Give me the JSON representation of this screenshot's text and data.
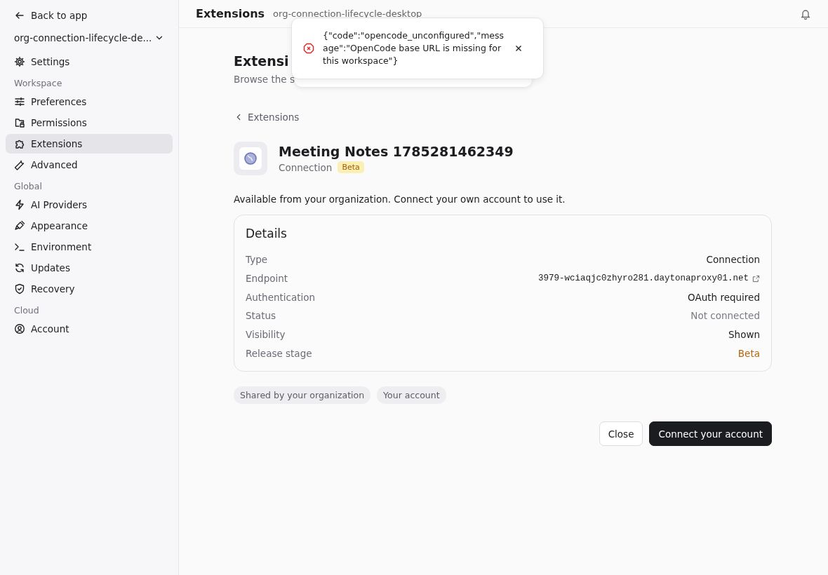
{
  "sidebar": {
    "back": "Back to app",
    "workspace": "org-connection-lifecycle-de...",
    "items": [
      {
        "kind": "item",
        "label": "Settings",
        "selected": false
      },
      {
        "kind": "section",
        "label": "Workspace"
      },
      {
        "kind": "item",
        "label": "Preferences",
        "selected": false
      },
      {
        "kind": "item",
        "label": "Permissions",
        "selected": false
      },
      {
        "kind": "item",
        "label": "Extensions",
        "selected": true
      },
      {
        "kind": "item",
        "label": "Advanced",
        "selected": false
      },
      {
        "kind": "section",
        "label": "Global"
      },
      {
        "kind": "item",
        "label": "AI Providers",
        "selected": false
      },
      {
        "kind": "item",
        "label": "Appearance",
        "selected": false
      },
      {
        "kind": "item",
        "label": "Environment",
        "selected": false
      },
      {
        "kind": "item",
        "label": "Updates",
        "selected": false
      },
      {
        "kind": "item",
        "label": "Recovery",
        "selected": false
      },
      {
        "kind": "section",
        "label": "Cloud"
      },
      {
        "kind": "item",
        "label": "Account",
        "selected": false
      }
    ]
  },
  "header": {
    "title": "Extensions",
    "subtitle": "org-connection-lifecycle-desktop"
  },
  "toast": {
    "message": "{\"code\":\"opencode_unconfigured\",\"message\":\"OpenCode base URL is missing for this workspace\"}"
  },
  "page": {
    "title": "Extensi",
    "subtitle": "Browse the s"
  },
  "breadcrumb": "Extensions",
  "extension": {
    "name": "Meeting Notes 1785281462349",
    "type": "Connection",
    "badge": "Beta"
  },
  "description": "Available from your organization. Connect your own account to use it.",
  "details": {
    "title": "Details",
    "rows": [
      {
        "label": "Type",
        "value": "Connection",
        "kind": "plain"
      },
      {
        "label": "Endpoint",
        "value": "3979-wciaqjc0zhyro281.daytonaproxy01.net",
        "kind": "link"
      },
      {
        "label": "Authentication",
        "value": "OAuth required",
        "kind": "plain"
      },
      {
        "label": "Status",
        "value": "Not connected",
        "kind": "muted"
      },
      {
        "label": "Visibility",
        "value": "Shown",
        "kind": "plain"
      },
      {
        "label": "Release stage",
        "value": "Beta",
        "kind": "warning"
      }
    ]
  },
  "tags": [
    "Shared by your organization",
    "Your account"
  ],
  "buttons": [
    {
      "label": "Close",
      "kind": "secondary"
    },
    {
      "label": "Connect your account",
      "kind": "primary"
    }
  ]
}
